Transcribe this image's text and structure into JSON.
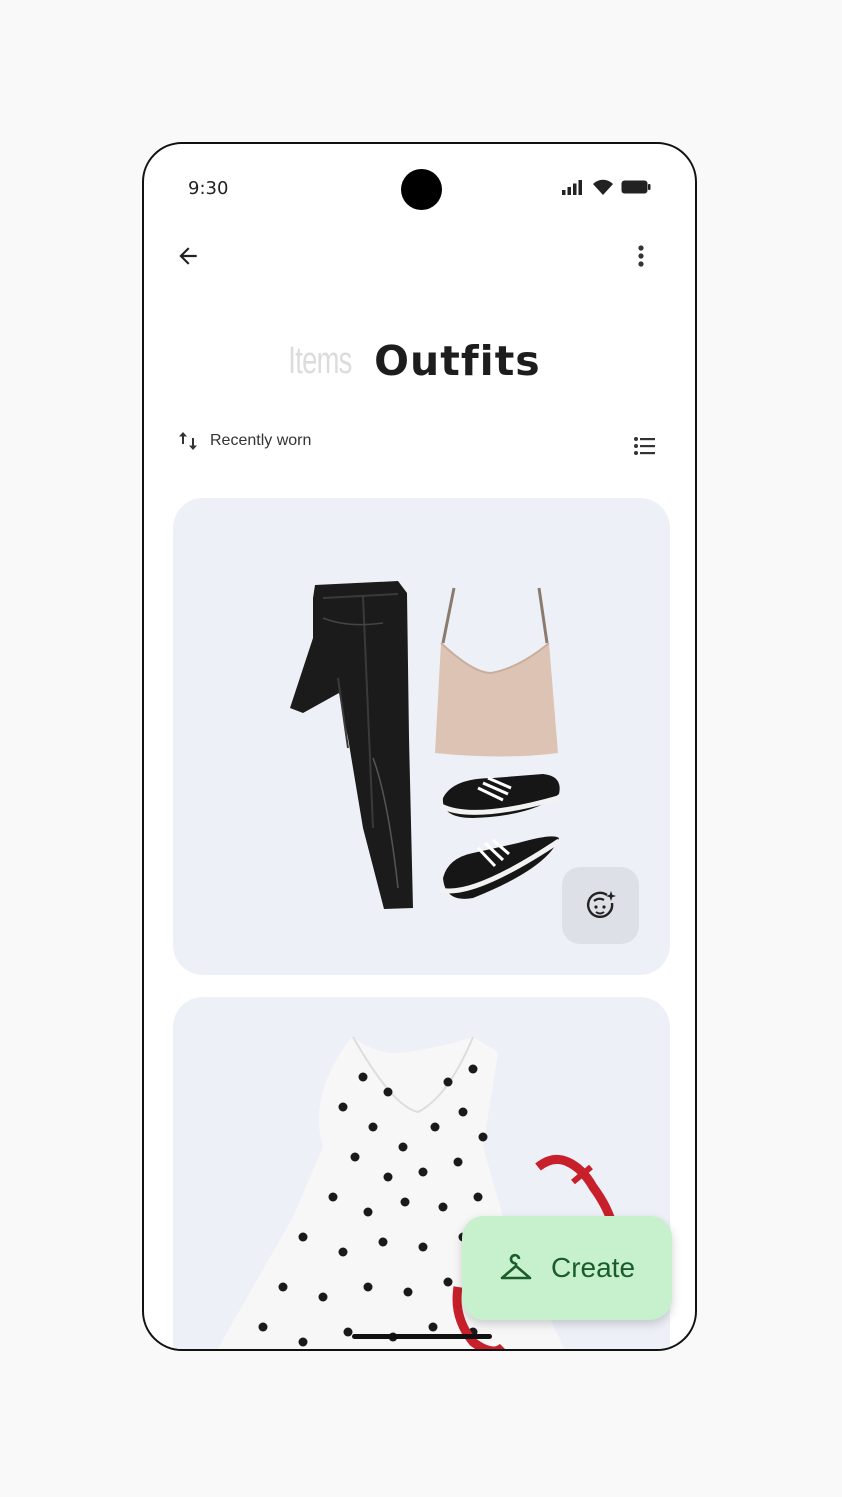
{
  "status_bar": {
    "time": "9:30"
  },
  "header": {
    "tabs": [
      {
        "label": "Items",
        "active": false
      },
      {
        "label": "Outfits",
        "active": true
      }
    ]
  },
  "toolbar": {
    "sort_label": "Recently worn",
    "sort_icon": "swap-vert-icon",
    "view_icon": "list-view-icon"
  },
  "outfits": [
    {
      "items": [
        "black leather pants",
        "beige cami top",
        "black sneakers"
      ],
      "action_icon": "virtual-try-on-icon"
    },
    {
      "items": [
        "polka dot dress",
        "red heels"
      ]
    }
  ],
  "fab": {
    "label": "Create",
    "icon": "hanger-icon"
  },
  "colors": {
    "card_bg": "#edf1f7",
    "fab_bg": "#c7f0cc",
    "fab_text": "#1a5c2a"
  }
}
